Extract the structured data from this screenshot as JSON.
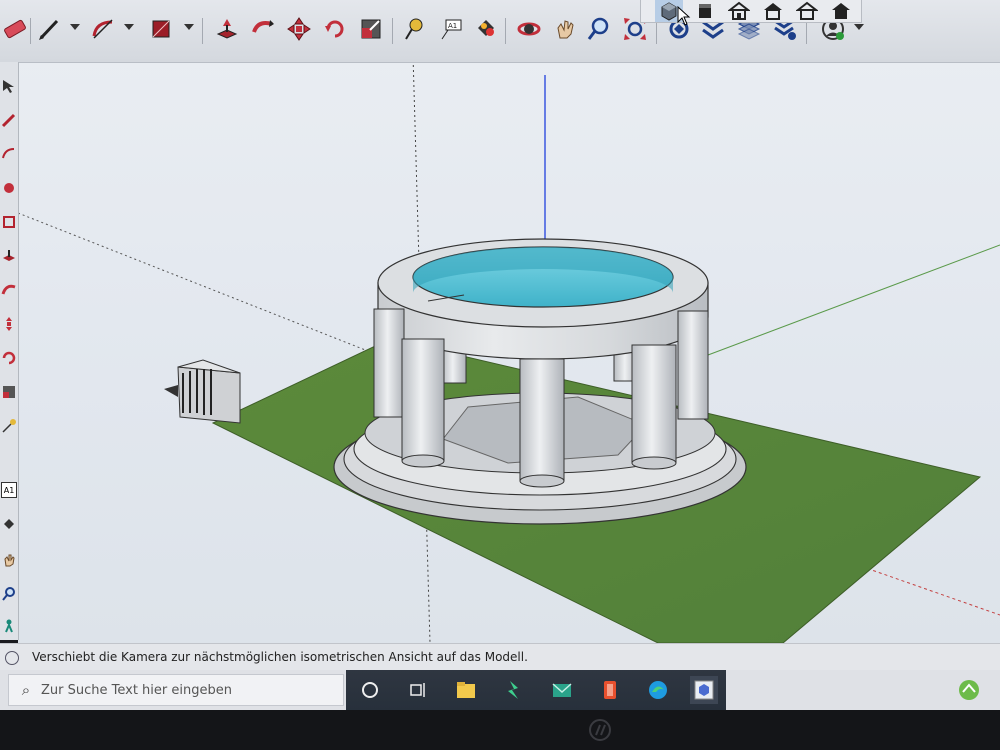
{
  "statusbar": {
    "message": "Verschiebt die Kamera zur nächstmöglichen isometrischen Ansicht auf das Modell."
  },
  "taskbar": {
    "search_placeholder": "Zur Suche Text hier eingeben",
    "apps": [
      "cortana-icon",
      "task-view-icon",
      "file-explorer-icon",
      "winscp-icon",
      "mail-icon",
      "office-icon",
      "edge-icon",
      "sketchup-icon"
    ]
  },
  "toolbar": {
    "tools": [
      "eraser-icon",
      "pencil-icon",
      "arc-icon",
      "rectangle-icon",
      "push-pull-icon",
      "follow-me-icon",
      "move-icon",
      "rotate-icon",
      "scale-icon",
      "tape-measure-icon",
      "text-icon",
      "paint-bucket-icon",
      "orbit-icon",
      "pan-icon",
      "zoom-icon",
      "zoom-extents-icon",
      "section-icon",
      "x-ray-icon",
      "layers-icon",
      "styles-icon",
      "account-icon"
    ],
    "views": [
      "iso-view-icon",
      "top-view-icon",
      "front-view-icon",
      "right-view-icon",
      "back-view-icon",
      "left-view-icon"
    ]
  },
  "left_toolbar": {
    "text_tool_label": "A1"
  },
  "colors": {
    "ground": "#5f8a3c",
    "stone": "#dadcde",
    "water": "#5fc6d8",
    "sky": "#e6eaf0",
    "axis_blue": "#3b57e0",
    "axis_green": "#5a9a4a",
    "axis_red": "#c44040"
  }
}
